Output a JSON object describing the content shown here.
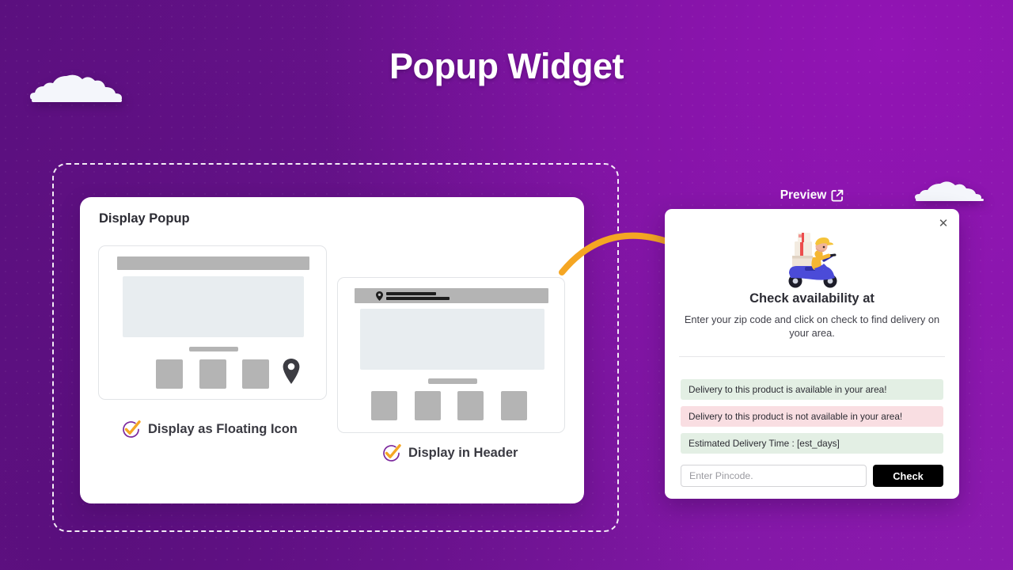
{
  "page": {
    "title": "Popup Widget",
    "background_color": "#7a16a0",
    "accent_color": "#f5a623"
  },
  "display_panel": {
    "card_title": "Display Popup",
    "options": [
      {
        "label": "Display as Floating Icon",
        "icon": "check-circle-icon",
        "checked": true
      },
      {
        "label": "Display in Header",
        "icon": "check-circle-icon",
        "checked": true
      }
    ],
    "wireframes": {
      "floating": {
        "icon": "map-pin-icon",
        "block_count": 3
      },
      "header": {
        "icon": "map-pin-icon",
        "block_count": 4
      }
    }
  },
  "preview": {
    "label": "Preview",
    "link_icon": "external-link-icon",
    "popup": {
      "close_icon": "close-icon",
      "illustration": "delivery-scooter-icon",
      "heading": "Check availability at",
      "subtext": "Enter your zip code and click on check to find delivery on your area.",
      "messages": [
        {
          "text": "Delivery to this product is available in your area!",
          "state": "success",
          "color": "#e3efe4"
        },
        {
          "text": "Delivery to this product is not available in your area!",
          "state": "error",
          "color": "#f9dee2"
        },
        {
          "text": "Estimated Delivery Time : [est_days]",
          "state": "info",
          "color": "#e3efe4"
        }
      ],
      "input_placeholder": "Enter Pincode.",
      "input_value": "",
      "button_label": "Check"
    }
  }
}
